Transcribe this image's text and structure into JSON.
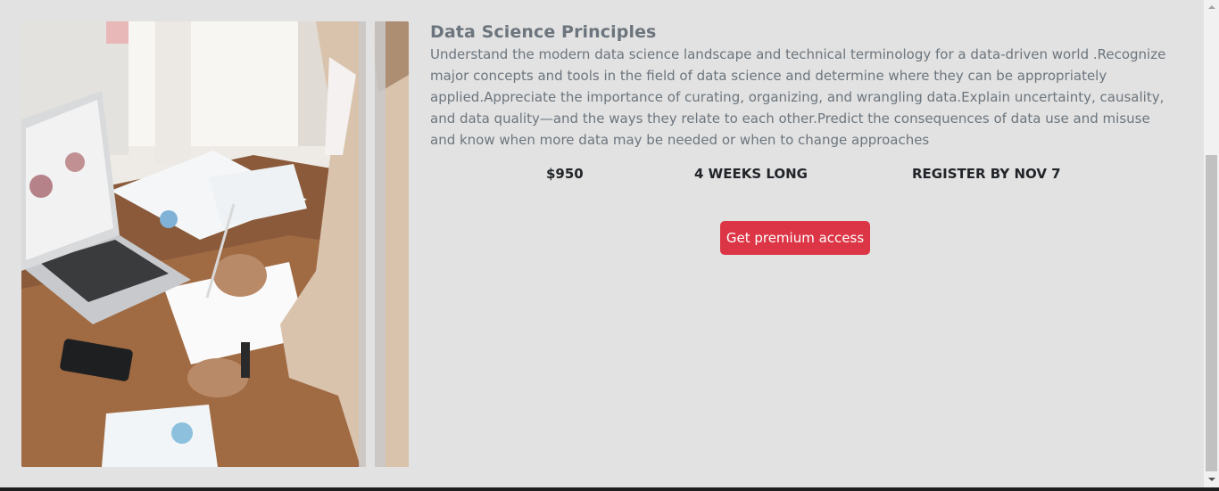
{
  "course": {
    "title": "Data Science Principles",
    "description": "Understand the modern data science landscape and technical terminology for a data-driven world .Recognize major concepts and tools in the field of data science and determine where they can be appropriately applied.Appreciate the importance of curating, organizing, and wrangling data.Explain uncertainty, causality, and data quality—and the ways they relate to each other.Predict the consequences of data use and misuse and know when more data may be needed or when to change approaches",
    "price": "$950",
    "duration": "4 WEEKS LONG",
    "register_by": "REGISTER BY NOV 7",
    "cta_label": "Get premium access"
  },
  "colors": {
    "background": "#e2e2e2",
    "cta": "#dc3545",
    "muted_text": "#6c757d",
    "dark_text": "#212529"
  },
  "image": {
    "icon": "photo-icon"
  }
}
